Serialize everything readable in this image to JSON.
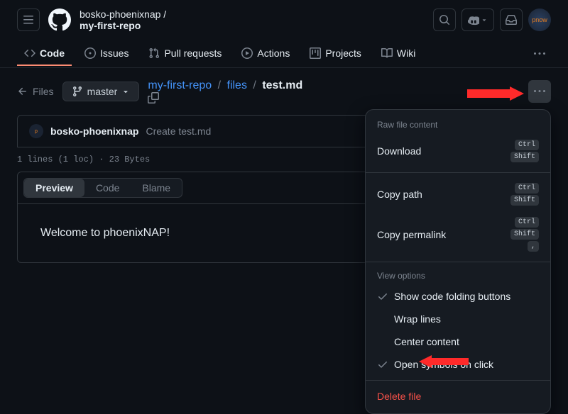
{
  "header": {
    "owner": "bosko-phoenixnap",
    "repo": "my-first-repo",
    "avatar_text": "pnow"
  },
  "nav": {
    "code": "Code",
    "issues": "Issues",
    "pulls": "Pull requests",
    "actions": "Actions",
    "projects": "Projects",
    "wiki": "Wiki"
  },
  "file_header": {
    "back_label": "Files",
    "branch": "master",
    "breadcrumb_repo": "my-first-repo",
    "breadcrumb_dir": "files",
    "breadcrumb_file": "test.md"
  },
  "commit": {
    "author": "bosko-phoenixnap",
    "message": "Create test.md"
  },
  "stats": "1 lines (1 loc) · 23 Bytes",
  "view_tabs": {
    "preview": "Preview",
    "code": "Code",
    "blame": "Blame"
  },
  "content": "Welcome to phoenixNAP!",
  "dropdown": {
    "raw_label": "Raw file content",
    "download": "Download",
    "copy_path": "Copy path",
    "copy_permalink": "Copy permalink",
    "view_label": "View options",
    "folding": "Show code folding buttons",
    "wrap": "Wrap lines",
    "center": "Center content",
    "symbols": "Open symbols on click",
    "delete": "Delete file",
    "kbd_ctrl": "Ctrl",
    "kbd_shift": "Shift",
    "kbd_comma": ","
  }
}
